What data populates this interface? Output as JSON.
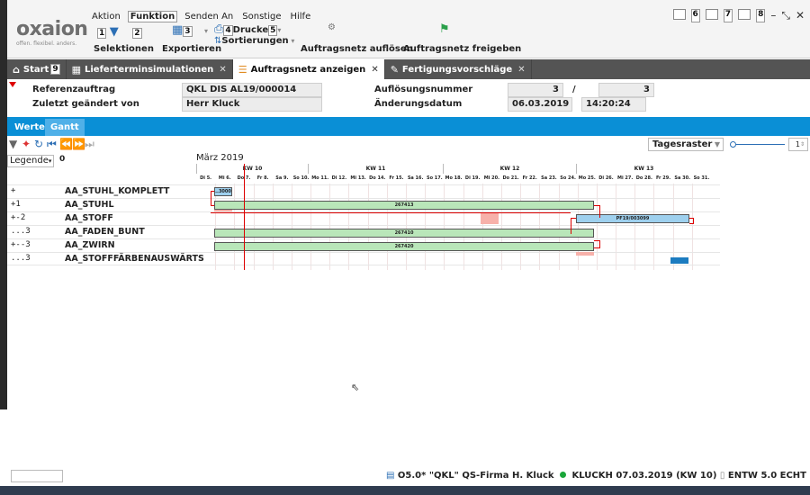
{
  "app": {
    "logo_name": "oxaion",
    "logo_tag": "offen. flexibel. anders."
  },
  "menu": [
    "Aktion",
    "Funktion",
    "Senden An",
    "Sonstige",
    "Hilfe"
  ],
  "ribbon": {
    "selektionen": "Selektionen",
    "exportieren": "Exportieren",
    "drucke": "Drucke",
    "sortierungen": "Sortierungen",
    "aufloesen": "Auftragsnetz auflösen",
    "freigeben": "Auftragsnetz freigeben",
    "key_1": "1",
    "key_2": "2",
    "key_3": "3",
    "key_4": "4",
    "key_5": "5",
    "key_6": "6",
    "key_7": "7",
    "key_8": "8",
    "key_9": "9"
  },
  "tabs": [
    {
      "label": "Start"
    },
    {
      "label": "Lieferterminsimulationen"
    },
    {
      "label": "Auftragsnetz anzeigen"
    },
    {
      "label": "Fertigungsvorschläge"
    }
  ],
  "form": {
    "referenzauftrag_label": "Referenzauftrag",
    "referenzauftrag_value": "QKL DIS AL19/000014",
    "geaendert_label": "Zuletzt geändert von",
    "geaendert_value": "Herr Kluck",
    "aufloesungsnummer_label": "Auflösungsnummer",
    "aufloesungsnummer_value": "3",
    "slash": "/",
    "aufloesungsnummer_value2": "3",
    "aenderungsdatum_label": "Änderungsdatum",
    "aenderungsdatum_value": "06.03.2019",
    "aenderungszeit_value": "14:20:24"
  },
  "section_tabs": [
    {
      "label": "Werte"
    },
    {
      "label": "Gantt"
    }
  ],
  "gantt_toolbar": {
    "raster": "Tagesraster",
    "zoom": "1",
    "legende": "Legende",
    "legende_num": "0"
  },
  "timeline": {
    "month": "März 2019",
    "weeks": [
      "KW 10",
      "KW 11",
      "KW 12",
      "KW 13"
    ],
    "days": [
      "Di 5.",
      "Mi 6.",
      "Do 7.",
      "Fr 8.",
      "Sa 9.",
      "So 10.",
      "Mo 11.",
      "Di 12.",
      "Mi 13.",
      "Do 14.",
      "Fr 15.",
      "Sa 16.",
      "So 17.",
      "Mo 18.",
      "Di 19.",
      "Mi 20.",
      "Do 21.",
      "Fr 22.",
      "Sa 23.",
      "So 24.",
      "Mo 25.",
      "Di 26.",
      "Mi 27.",
      "Do 28.",
      "Fr 29.",
      "Sa 30.",
      "So 31."
    ]
  },
  "rows": [
    {
      "level": "+",
      "name": "AA_STUHL_KOMPLETT",
      "bar_label": "..3000"
    },
    {
      "level": "+1",
      "name": "AA_STUHL",
      "bar_label": "267413"
    },
    {
      "level": "+-2",
      "name": "AA_STOFF",
      "bar_label": "PF19/003099"
    },
    {
      "level": "...3",
      "name": "AA_FADEN_BUNT",
      "bar_label": "267410"
    },
    {
      "level": "+--3",
      "name": "AA_ZWIRN",
      "bar_label": "267420"
    },
    {
      "level": "...3",
      "name": "AA_STOFFFÄRBENAUSWÄRTS",
      "bar_label": ""
    }
  ],
  "status": {
    "program": "O5.0* \"QKL\"",
    "firma": "QS-Firma H. Kluck",
    "user": "KLUCKH",
    "date": "07.03.2019 (KW 10)",
    "env": "ENTW 5.0 ECHT"
  },
  "colors": {
    "accent_blue": "#0a8fd6",
    "tabbar": "#545454",
    "bar_green": "#b9e6b9",
    "bar_blue": "#9ed0ee",
    "today_line": "#dd0000"
  }
}
